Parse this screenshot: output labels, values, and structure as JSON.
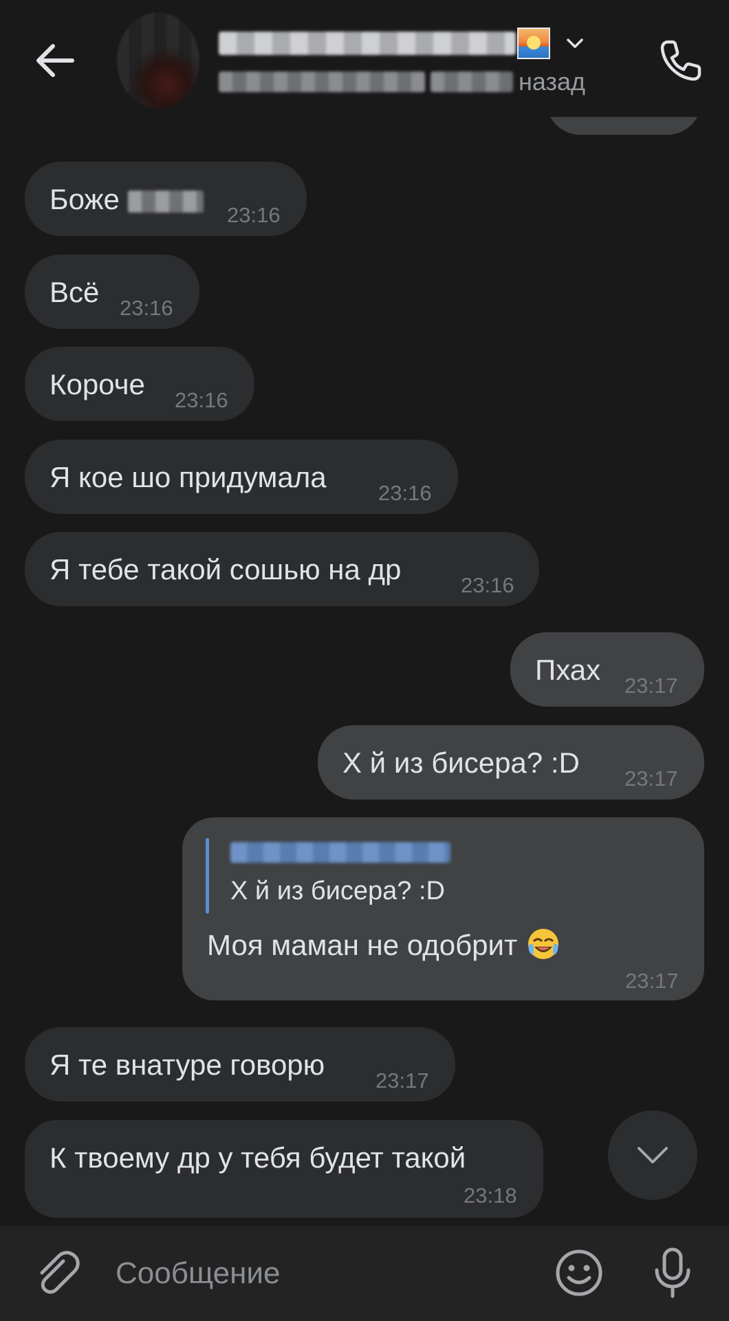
{
  "header": {
    "back_icon": "arrow-left-icon",
    "chevron_icon": "chevron-down-icon",
    "call_icon": "phone-icon",
    "subtitle_tail": "назад"
  },
  "messages": [
    {
      "text": "Боже",
      "time": "23:16",
      "direction": "in",
      "note": "redacted-tail"
    },
    {
      "text": "Всё",
      "time": "23:16",
      "direction": "in"
    },
    {
      "text": "Короче",
      "time": "23:16",
      "direction": "in"
    },
    {
      "text": "Я кое шо придумала",
      "time": "23:16",
      "direction": "in"
    },
    {
      "text": "Я тебе такой сошью на др",
      "time": "23:16",
      "direction": "in"
    },
    {
      "text": "Пхах",
      "time": "23:17",
      "direction": "out"
    },
    {
      "text": "Х й из бисера? :D",
      "time": "23:17",
      "direction": "out"
    },
    {
      "reply_text": "Х й из бисера? :D",
      "text": "Моя маман не одобрит",
      "emoji": "face-with-tears-of-joy-icon",
      "time": "23:17",
      "direction": "out"
    },
    {
      "text": "Я те внатуре говорю",
      "time": "23:17",
      "direction": "in"
    },
    {
      "text": "К твоему др у тебя будет такой",
      "time": "23:18",
      "direction": "in"
    }
  ],
  "composer": {
    "placeholder": "Сообщение",
    "attach_icon": "paperclip-icon",
    "emoji_icon": "smiley-icon",
    "mic_icon": "microphone-icon"
  },
  "scroll_down_icon": "chevron-down-icon",
  "colors": {
    "background": "#19191a",
    "incoming_bubble": "#2c2d2f",
    "outgoing_bubble": "#414244",
    "text": "#e1e3e6",
    "time": "#76787b",
    "reply_accent": "#5a8ed6"
  }
}
